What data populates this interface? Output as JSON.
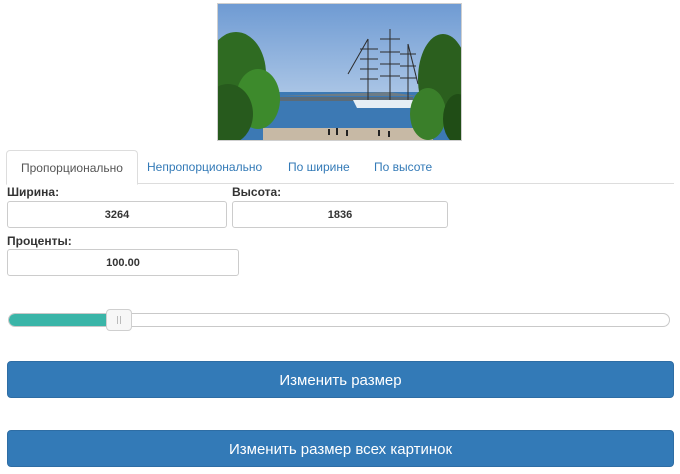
{
  "preview": {
    "alt": "photo-preview"
  },
  "tabs": [
    {
      "label": "Пропорционально",
      "active": true
    },
    {
      "label": "Непропорционально",
      "active": false
    },
    {
      "label": "По ширине",
      "active": false
    },
    {
      "label": "По высоте",
      "active": false
    }
  ],
  "width": {
    "label": "Ширина:",
    "value": "3264"
  },
  "height": {
    "label": "Высота:",
    "value": "1836"
  },
  "percent": {
    "label": "Проценты:",
    "value": "100.00"
  },
  "slider": {
    "fraction": 0.167,
    "fill_color": "#3ab5a8"
  },
  "buttons": {
    "resize": "Изменить размер",
    "resize_all": "Изменить размер всех картинок"
  },
  "colors": {
    "primary": "#337ab7",
    "link": "#337ab7",
    "accent": "#3ab5a8"
  }
}
